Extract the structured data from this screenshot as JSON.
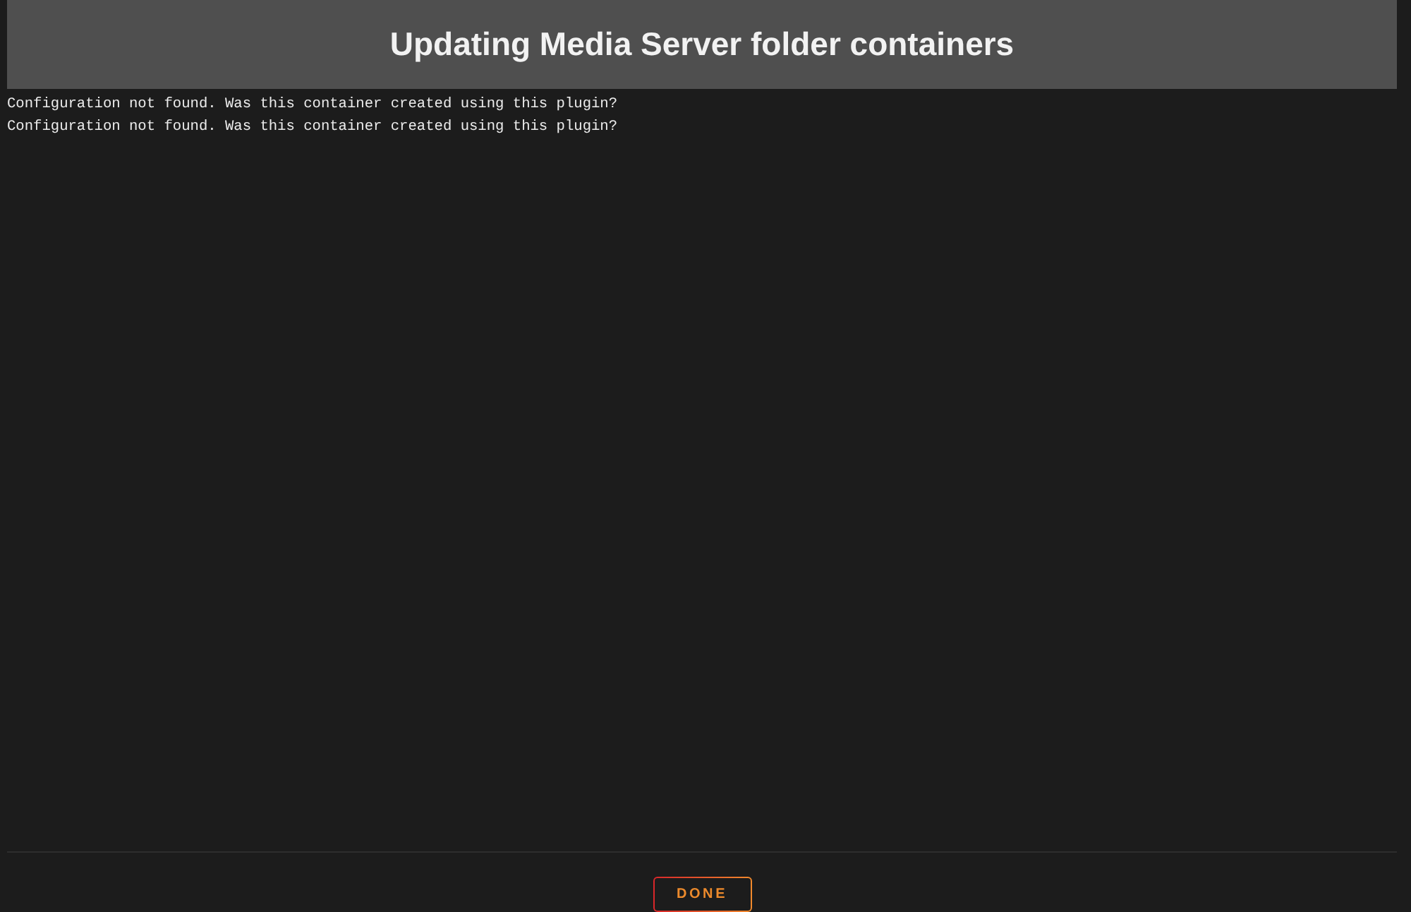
{
  "dialog": {
    "title": "Updating Media Server folder containers"
  },
  "log_lines": [
    "Configuration not found. Was this container created using this plugin?",
    "Configuration not found. Was this container created using this plugin?"
  ],
  "buttons": [
    {
      "label": "DONE"
    }
  ]
}
